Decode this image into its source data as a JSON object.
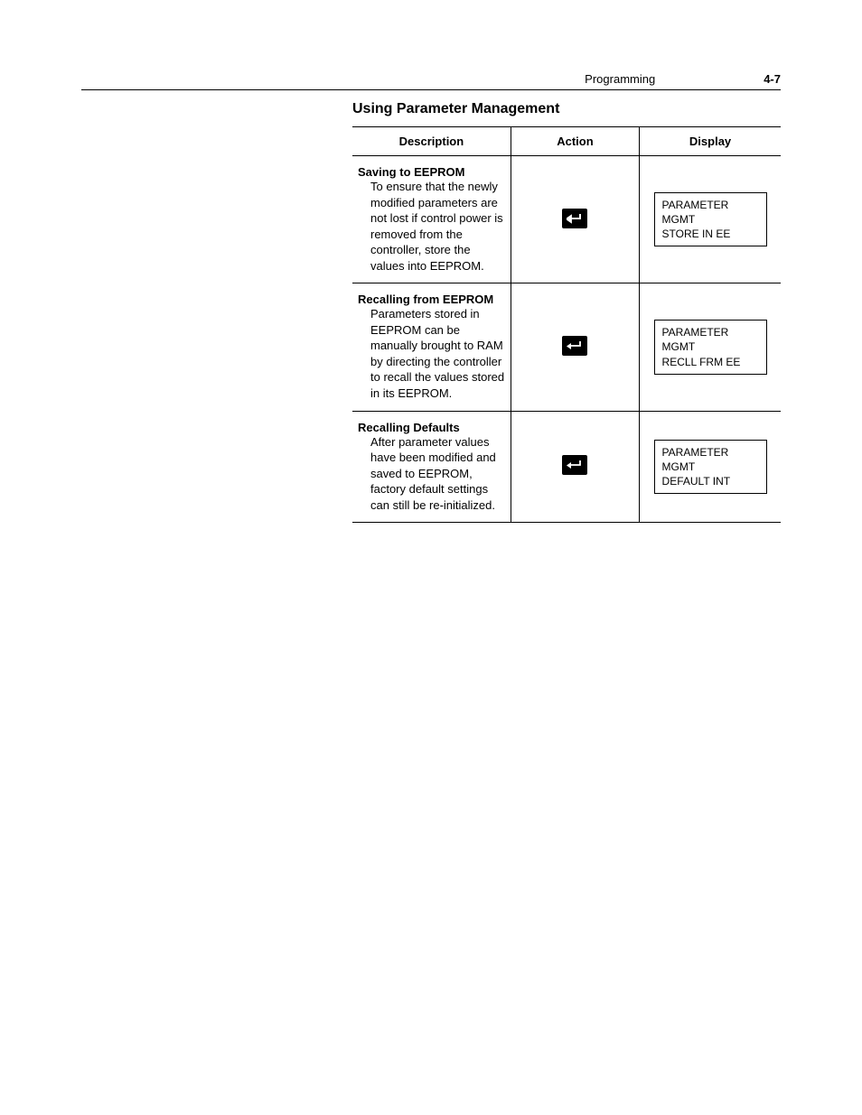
{
  "header": {
    "section": "Programming",
    "page": "4-7"
  },
  "title": "Using Parameter Management",
  "columns": {
    "description": "Description",
    "action": "Action",
    "display": "Display"
  },
  "rows": [
    {
      "title": "Saving to EEPROM",
      "text": "To ensure that the newly modified parameters are not lost if control power is removed from the controller, store the values into EEPROM.",
      "lcd_line1": "PARAMETER MGMT",
      "lcd_line2": "STORE IN EE"
    },
    {
      "title": "Recalling from EEPROM",
      "text": "Parameters stored in EEPROM can be manually brought to RAM by directing the controller to recall the values stored in its EEPROM.",
      "lcd_line1": "PARAMETER MGMT",
      "lcd_line2": "RECLL FRM EE"
    },
    {
      "title": "Recalling Defaults",
      "text": "After parameter values have been modified and saved to EEPROM, factory default settings can still be re-initialized.",
      "lcd_line1": "PARAMETER MGMT",
      "lcd_line2": "DEFAULT INT"
    }
  ]
}
